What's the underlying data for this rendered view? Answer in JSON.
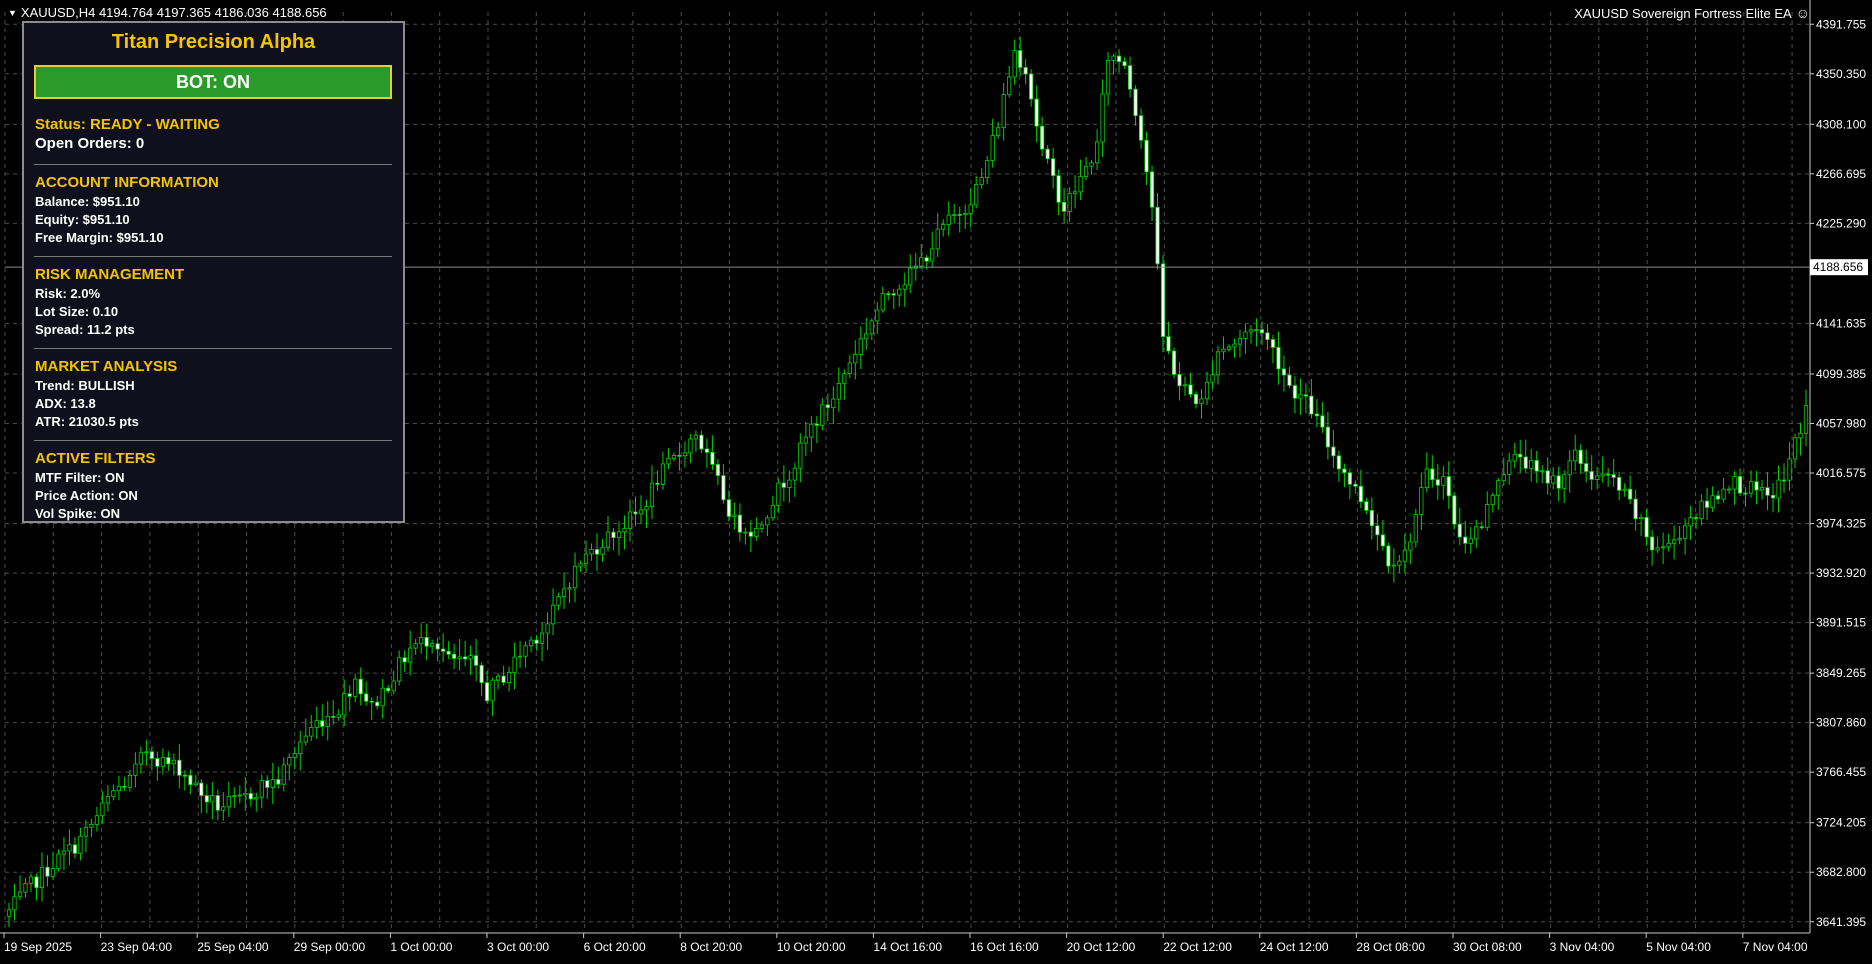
{
  "header": {
    "symbol_line": "XAUUSD,H4  4194.764 4197.365 4186.036 4188.656",
    "ea_name": "XAUUSD Sovereign Fortress Elite EA",
    "ea_icon": "smiley-icon"
  },
  "panel": {
    "title": "Titan Precision Alpha",
    "bot_button": "BOT: ON",
    "status": "Status: READY - WAITING",
    "open_orders": "Open Orders: 0",
    "account": {
      "heading": "ACCOUNT INFORMATION",
      "balance": "Balance: $951.10",
      "equity": "Equity: $951.10",
      "free_margin": "Free Margin: $951.10"
    },
    "risk": {
      "heading": "RISK MANAGEMENT",
      "risk": "Risk: 2.0%",
      "lot": "Lot Size: 0.10",
      "spread": "Spread: 11.2 pts"
    },
    "market": {
      "heading": "MARKET ANALYSIS",
      "trend": "Trend: BULLISH",
      "adx": "ADX: 13.8",
      "atr": "ATR: 21030.5 pts"
    },
    "filters": {
      "heading": "ACTIVE FILTERS",
      "mtf": "MTF Filter: ON",
      "price_action": "Price Action: ON",
      "vol_spike": "Vol Spike: ON"
    }
  },
  "colors": {
    "background": "#000000",
    "grid": "#4a4a4a",
    "bull": "#00d400",
    "bear_fill": "#ffffff",
    "accent": "#f4c400",
    "button": "#2a9a2a"
  },
  "chart_data": {
    "type": "candlestick",
    "symbol": "XAUUSD",
    "timeframe": "H4",
    "current_price": "4188.656",
    "price_labels": [
      "4391.755",
      "4350.350",
      "4308.100",
      "4266.695",
      "4225.290",
      "4141.635",
      "4099.385",
      "4057.980",
      "4016.575",
      "3974.325",
      "3932.920",
      "3891.515",
      "3849.265",
      "3807.860",
      "3766.455",
      "3724.205",
      "3682.800",
      "3641.395"
    ],
    "ylim": [
      3632,
      4402
    ],
    "time_labels": [
      "19 Sep 2025",
      "23 Sep 04:00",
      "25 Sep 04:00",
      "29 Sep 00:00",
      "1 Oct 00:00",
      "3 Oct 00:00",
      "6 Oct 20:00",
      "8 Oct 20:00",
      "10 Oct 20:00",
      "14 Oct 16:00",
      "16 Oct 16:00",
      "20 Oct 12:00",
      "22 Oct 12:00",
      "24 Oct 12:00",
      "28 Oct 08:00",
      "30 Oct 08:00",
      "3 Nov 04:00",
      "5 Nov 04:00",
      "7 Nov 04:00"
    ],
    "path": [
      [
        0,
        3650
      ],
      [
        4,
        3672
      ],
      [
        8,
        3690
      ],
      [
        12,
        3705
      ],
      [
        15,
        3722
      ],
      [
        19,
        3750
      ],
      [
        22,
        3760
      ],
      [
        25,
        3785
      ],
      [
        28,
        3775
      ],
      [
        31,
        3770
      ],
      [
        35,
        3748
      ],
      [
        38,
        3738
      ],
      [
        42,
        3742
      ],
      [
        46,
        3755
      ],
      [
        49,
        3760
      ],
      [
        53,
        3792
      ],
      [
        56,
        3808
      ],
      [
        60,
        3820
      ],
      [
        63,
        3845
      ],
      [
        66,
        3820
      ],
      [
        70,
        3848
      ],
      [
        73,
        3870
      ],
      [
        77,
        3880
      ],
      [
        80,
        3860
      ],
      [
        84,
        3858
      ],
      [
        87,
        3832
      ],
      [
        91,
        3852
      ],
      [
        94,
        3872
      ],
      [
        98,
        3890
      ],
      [
        101,
        3920
      ],
      [
        104,
        3942
      ],
      [
        108,
        3960
      ],
      [
        111,
        3970
      ],
      [
        115,
        3985
      ],
      [
        118,
        4012
      ],
      [
        122,
        4033
      ],
      [
        125,
        4050
      ],
      [
        129,
        4008
      ],
      [
        132,
        3975
      ],
      [
        136,
        3968
      ],
      [
        139,
        3995
      ],
      [
        143,
        4025
      ],
      [
        146,
        4055
      ],
      [
        150,
        4080
      ],
      [
        153,
        4110
      ],
      [
        157,
        4145
      ],
      [
        160,
        4168
      ],
      [
        164,
        4182
      ],
      [
        167,
        4200
      ],
      [
        170,
        4222
      ],
      [
        174,
        4240
      ],
      [
        177,
        4262
      ],
      [
        180,
        4310
      ],
      [
        183,
        4370
      ],
      [
        185,
        4355
      ],
      [
        188,
        4285
      ],
      [
        192,
        4238
      ],
      [
        195,
        4262
      ],
      [
        198,
        4290
      ],
      [
        200,
        4365
      ],
      [
        203,
        4360
      ],
      [
        206,
        4300
      ],
      [
        208,
        4240
      ],
      [
        210,
        4130
      ],
      [
        213,
        4090
      ],
      [
        217,
        4075
      ],
      [
        220,
        4120
      ],
      [
        223,
        4125
      ],
      [
        227,
        4140
      ],
      [
        230,
        4120
      ],
      [
        233,
        4090
      ],
      [
        237,
        4070
      ],
      [
        240,
        4040
      ],
      [
        244,
        4010
      ],
      [
        247,
        3988
      ],
      [
        251,
        3945
      ],
      [
        254,
        3948
      ],
      [
        258,
        4015
      ],
      [
        261,
        4012
      ],
      [
        264,
        3960
      ],
      [
        268,
        3972
      ],
      [
        271,
        4015
      ],
      [
        275,
        4032
      ],
      [
        278,
        4015
      ],
      [
        282,
        4010
      ],
      [
        285,
        4030
      ],
      [
        288,
        4015
      ],
      [
        292,
        4010
      ],
      [
        295,
        3990
      ],
      [
        299,
        3955
      ],
      [
        302,
        3955
      ],
      [
        306,
        3980
      ],
      [
        309,
        3990
      ],
      [
        313,
        4010
      ],
      [
        316,
        4005
      ],
      [
        320,
        3995
      ],
      [
        323,
        4012
      ],
      [
        327,
        4070
      ]
    ]
  }
}
